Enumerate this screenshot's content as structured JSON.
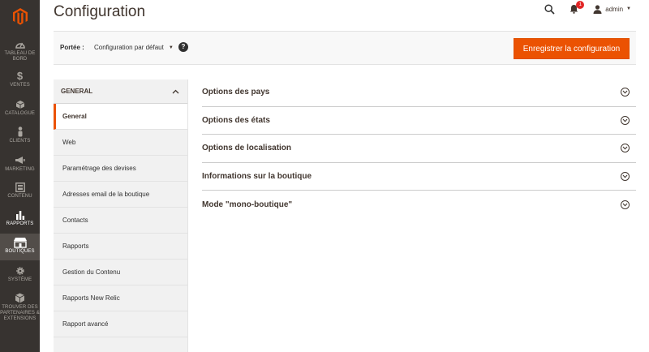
{
  "sidebar": {
    "items": [
      {
        "label_line1": "TABLEAU DE",
        "label_line2": "BORD",
        "icon": "dashboard-icon"
      },
      {
        "label_line1": "VENTES",
        "label_line2": "",
        "icon": "dollar-icon"
      },
      {
        "label_line1": "CATALOGUE",
        "label_line2": "",
        "icon": "cube-icon"
      },
      {
        "label_line1": "CLIENTS",
        "label_line2": "",
        "icon": "person-icon"
      },
      {
        "label_line1": "MARKETING",
        "label_line2": "",
        "icon": "megaphone-icon"
      },
      {
        "label_line1": "CONTENU",
        "label_line2": "",
        "icon": "layout-icon"
      },
      {
        "label_line1": "RAPPORTS",
        "label_line2": "",
        "icon": "bar-chart-icon"
      },
      {
        "label_line1": "BOUTIQUES",
        "label_line2": "",
        "icon": "store-icon"
      },
      {
        "label_line1": "SYSTÈME",
        "label_line2": "",
        "icon": "gear-icon"
      },
      {
        "label_line1": "TROUVER DES",
        "label_line2": "PARTENAIRES &",
        "label_line3": "EXTENSIONS",
        "icon": "blocks-icon"
      }
    ],
    "active_item": "BOUTIQUES"
  },
  "header": {
    "title": "Configuration",
    "notification_count": "1",
    "user": "admin"
  },
  "scope": {
    "label": "Portée :",
    "selected": "Configuration par défaut",
    "help": "?"
  },
  "actions": {
    "save_label": "Enregistrer la configuration"
  },
  "tabs": {
    "group_title": "GENERAL",
    "items": [
      "General",
      "Web",
      "Paramétrage des devises",
      "Adresses email de la boutique",
      "Contacts",
      "Rapports",
      "Gestion du Contenu",
      "Rapports New Relic",
      "Rapport avancé"
    ],
    "active_index": 0
  },
  "sections": [
    "Options des pays",
    "Options des états",
    "Options de localisation",
    "Informations sur la boutique",
    "Mode \"mono-boutique\""
  ],
  "colors": {
    "sidebar_bg": "#373330",
    "accent": "#eb5202",
    "badge": "#e22626"
  }
}
